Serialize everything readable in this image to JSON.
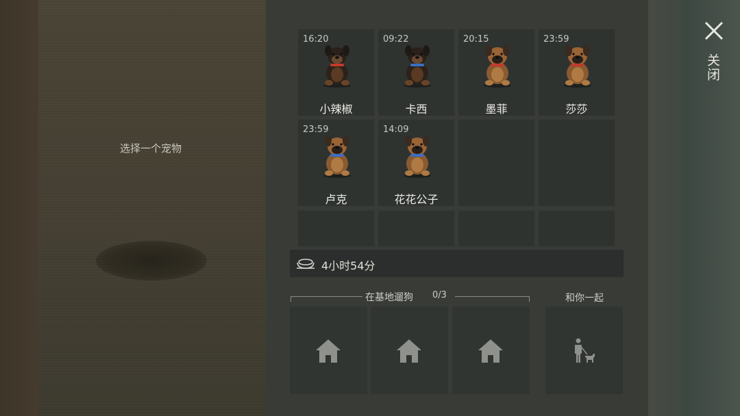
{
  "left_panel": {
    "hint": "选择一个宠物"
  },
  "pets": [
    {
      "time": "16:20",
      "name": "小辣椒",
      "variant": "dark",
      "collar": "#c23b2c"
    },
    {
      "time": "09:22",
      "name": "卡西",
      "variant": "dark",
      "collar": "#3a6fc4"
    },
    {
      "time": "20:15",
      "name": "墨菲",
      "variant": "tan",
      "collar": "#c23b2c"
    },
    {
      "time": "23:59",
      "name": "莎莎",
      "variant": "tan",
      "collar": "#c23b2c"
    },
    {
      "time": "23:59",
      "name": "卢克",
      "variant": "tan",
      "collar": "#3a6fc4"
    },
    {
      "time": "14:09",
      "name": "花花公子",
      "variant": "tan",
      "collar": "#3a6fc4"
    }
  ],
  "food": {
    "icon": "bowl-icon",
    "text": "4小时54分"
  },
  "walk": {
    "label": "在基地遛狗",
    "count": "0/3",
    "slots": [
      "house-icon",
      "house-icon",
      "house-icon"
    ]
  },
  "with_you": {
    "label": "和你一起",
    "icon": "person-with-dog-icon"
  },
  "close": {
    "label": "关闭",
    "icon": "close-icon"
  }
}
